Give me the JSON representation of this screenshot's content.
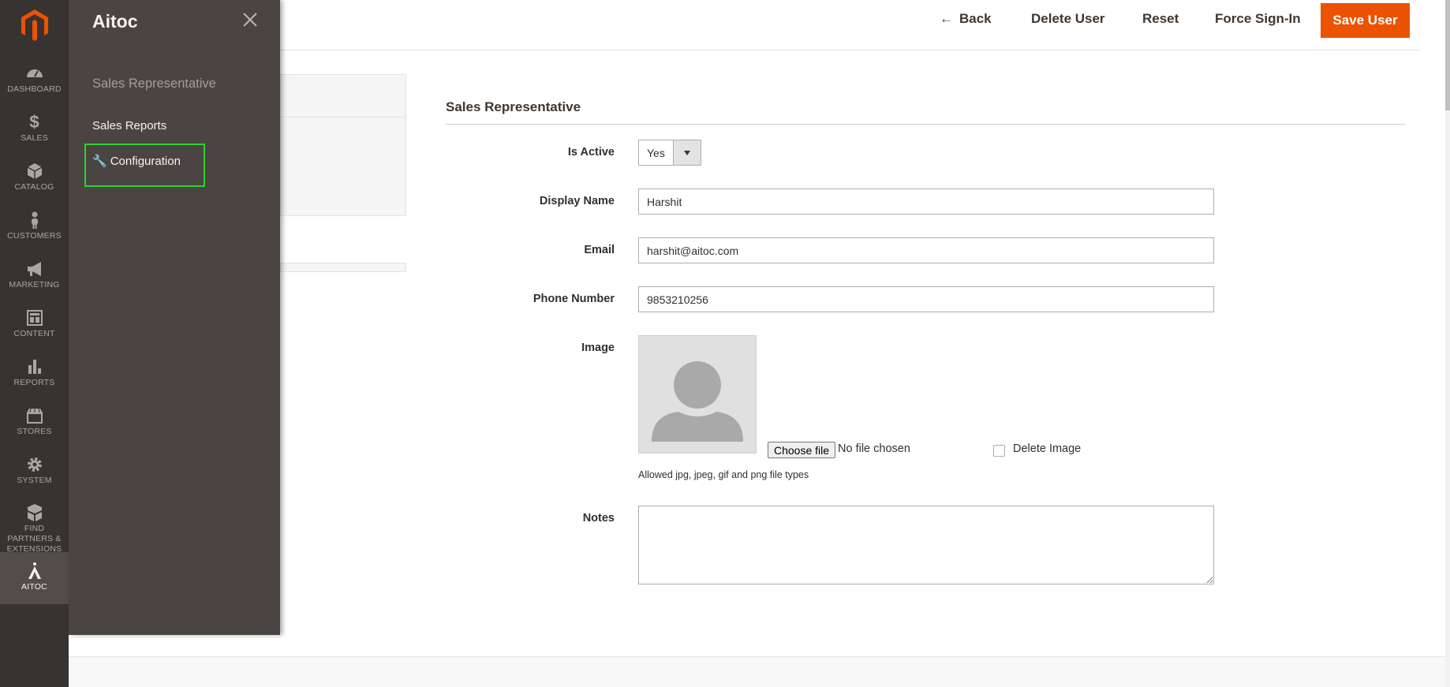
{
  "colors": {
    "rail_bg": "#373330",
    "flyout_bg": "#4a4542",
    "accent": "#eb5202",
    "highlight": "#2ed12e"
  },
  "rail": {
    "items": [
      {
        "label": "DASHBOARD",
        "icon": "dashboard-icon"
      },
      {
        "label": "SALES",
        "icon": "dollar-icon"
      },
      {
        "label": "CATALOG",
        "icon": "box-icon"
      },
      {
        "label": "CUSTOMERS",
        "icon": "person-icon"
      },
      {
        "label": "MARKETING",
        "icon": "megaphone-icon"
      },
      {
        "label": "CONTENT",
        "icon": "layout-icon"
      },
      {
        "label": "REPORTS",
        "icon": "bar-chart-icon"
      },
      {
        "label": "STORES",
        "icon": "store-icon"
      },
      {
        "label": "SYSTEM",
        "icon": "gear-icon"
      },
      {
        "label": "FIND PARTNERS & EXTENSIONS",
        "icon": "cubes-icon"
      },
      {
        "label": "AITOC",
        "icon": "aitoc-logo-icon"
      }
    ]
  },
  "flyout": {
    "title": "Aitoc",
    "section": "Sales Representative",
    "links": [
      "Sales Reports",
      "Configuration"
    ]
  },
  "header": {
    "back": "Back",
    "delete": "Delete User",
    "reset": "Reset",
    "force": "Force Sign-In",
    "save": "Save User"
  },
  "form": {
    "title": "Sales Representative",
    "is_active": {
      "label": "Is Active",
      "value": "Yes"
    },
    "display_name": {
      "label": "Display Name",
      "value": "Harshit"
    },
    "email": {
      "label": "Email",
      "value": "harshit@aitoc.com"
    },
    "phone": {
      "label": "Phone Number",
      "value": "9853210256"
    },
    "image": {
      "label": "Image",
      "choose": "Choose file",
      "no_file": "No file chosen",
      "delete": "Delete Image",
      "note": "Allowed jpg, jpeg, gif and png file types"
    },
    "notes": {
      "label": "Notes",
      "value": ""
    }
  }
}
